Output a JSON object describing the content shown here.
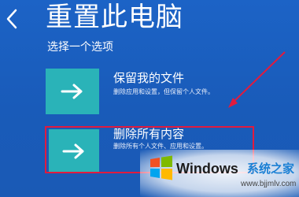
{
  "header": {
    "title": "重置此电脑"
  },
  "main": {
    "subtitle": "选择一个选项",
    "options": [
      {
        "title": "保留我的文件",
        "description": "删除应用和设置，但保留个人文件。",
        "icon": "right-arrow-icon"
      },
      {
        "title": "删除所有内容",
        "description": "删除所有个人文件、应用和设置。",
        "icon": "right-arrow-icon",
        "highlighted": true
      }
    ]
  },
  "annotation": {
    "highlight_color": "#e11b3e"
  },
  "watermark": {
    "brand": "Windows",
    "cn_text": "系统之家",
    "url": "www.bjjmlv.com"
  },
  "colors": {
    "background": "#1b5fbe",
    "tile": "#2ab3b8"
  }
}
